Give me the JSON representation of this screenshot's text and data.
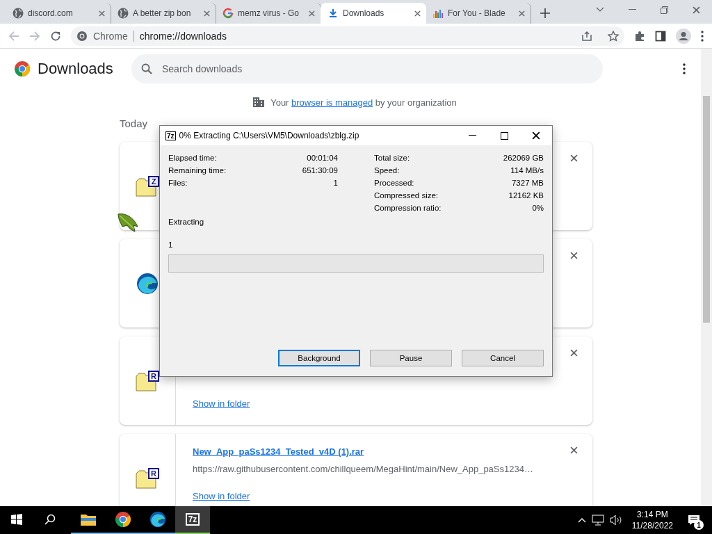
{
  "tabs": [
    {
      "title": "discord.com",
      "kind": "globe",
      "selected": false
    },
    {
      "title": "A better zip bon",
      "kind": "globe",
      "selected": false
    },
    {
      "title": "memz virus - Go",
      "kind": "google",
      "selected": false
    },
    {
      "title": "Downloads",
      "kind": "download",
      "selected": true
    },
    {
      "title": "For You - Blade",
      "kind": "bars",
      "selected": false
    }
  ],
  "toolbar": {
    "site_label": "Chrome",
    "url": "chrome://downloads"
  },
  "page": {
    "title": "Downloads",
    "search": {
      "placeholder": "Search downloads"
    },
    "notice": {
      "before": "Your ",
      "link": "browser is managed",
      "after": " by your organization"
    },
    "date": "Today",
    "downloads": [
      {
        "kind": "archive",
        "badge": "Z"
      },
      {
        "kind": "edge"
      },
      {
        "kind": "archive",
        "badge": "R",
        "show_link": "Show in folder"
      },
      {
        "kind": "archive",
        "badge": "R",
        "filename": "New_App_paSs1234_Tested_v4D (1).rar",
        "url": "https://raw.githubusercontent.com/chillqueem/MegaHint/main/New_App_paSs1234…",
        "show_link": "Show in folder"
      }
    ]
  },
  "dialog": {
    "logo": "7z",
    "title": "0% Extracting C:\\Users\\VM5\\Downloads\\zblg.zip",
    "stats_left": [
      {
        "label": "Elapsed time:",
        "value": "00:01:04"
      },
      {
        "label": "Remaining time:",
        "value": "651:30:09"
      },
      {
        "label": "Files:",
        "value": "1"
      }
    ],
    "stats_right": [
      {
        "label": "Total size:",
        "value": "262069 GB"
      },
      {
        "label": "Speed:",
        "value": "114 MB/s"
      },
      {
        "label": "Processed:",
        "value": "7327 MB"
      },
      {
        "label": "Compressed size:",
        "value": "12162 KB"
      },
      {
        "label": "Compression ratio:",
        "value": "0%"
      }
    ],
    "status": "Extracting",
    "current_file": "1",
    "progress": {
      "level": 0
    },
    "buttons": [
      {
        "label": "Background",
        "default": true
      },
      {
        "label": "Pause",
        "default": false
      },
      {
        "label": "Cancel",
        "default": false
      }
    ]
  },
  "taskbar": {
    "apps": [
      {
        "kind": "explorer",
        "running": true,
        "active": false
      },
      {
        "kind": "chrome",
        "running": true,
        "active": false
      },
      {
        "kind": "edge",
        "running": true,
        "active": false
      },
      {
        "kind": "sevenzip",
        "label": "7z",
        "running": true,
        "active": true
      }
    ],
    "time": "3:14 PM",
    "date": "11/28/2022",
    "notifications": "1"
  }
}
